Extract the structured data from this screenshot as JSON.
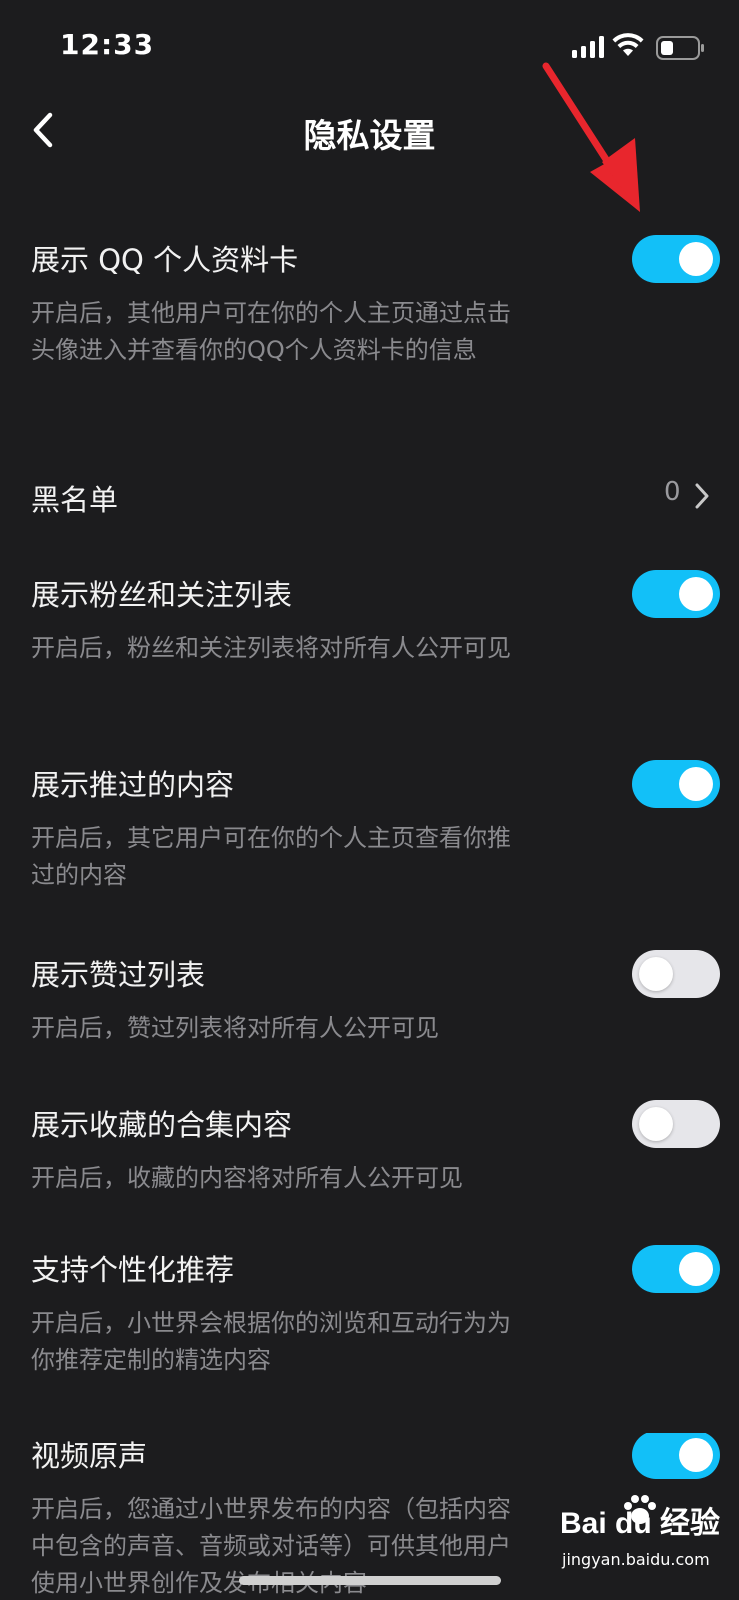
{
  "status_bar": {
    "time": "12:33"
  },
  "header": {
    "title": "隐私设置"
  },
  "settings": [
    {
      "title": "展示 QQ 个人资料卡",
      "description": "开启后，其他用户可在你的个人主页通过点击头像进入并查看你的QQ个人资料卡的信息",
      "enabled": true
    },
    {
      "title": "黑名单",
      "count": "0"
    },
    {
      "title": "展示粉丝和关注列表",
      "description": "开启后，粉丝和关注列表将对所有人公开可见",
      "enabled": true
    },
    {
      "title": "展示推过的内容",
      "description": "开启后，其它用户可在你的个人主页查看你推过的内容",
      "enabled": true
    },
    {
      "title": "展示赞过列表",
      "description": "开启后，赞过列表将对所有人公开可见",
      "enabled": false
    },
    {
      "title": "展示收藏的合集内容",
      "description": "开启后，收藏的内容将对所有人公开可见",
      "enabled": false
    },
    {
      "title": "支持个性化推荐",
      "description": "开启后，小世界会根据你的浏览和互动行为为你推荐定制的精选内容",
      "enabled": true
    },
    {
      "title": "视频原声",
      "description": "开启后，您通过小世界发布的内容（包括内容中包含的声音、音频或对话等）可供其他用户使用小世界创作及发布相关内容",
      "enabled": true
    }
  ],
  "watermark": {
    "logo": "Bai du 经验",
    "url": "jingyan.baidu.com"
  },
  "colors": {
    "background": "#1c1c1e",
    "toggle_on": "#12c0f8",
    "toggle_off": "#e6e6ea",
    "annotation_arrow": "#e8262d"
  }
}
